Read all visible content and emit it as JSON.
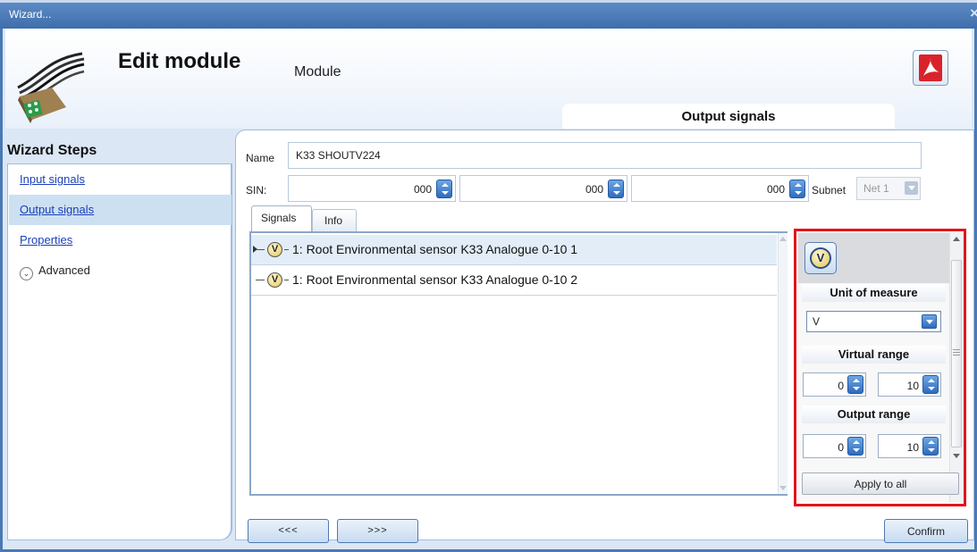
{
  "window": {
    "title": "Wizard...",
    "close": "×"
  },
  "header": {
    "title": "Edit module",
    "subtitle": "Module",
    "step_tab": "Output signals"
  },
  "sidebar": {
    "title": "Wizard Steps",
    "items": [
      {
        "label": "Input signals",
        "selected": false
      },
      {
        "label": "Output signals",
        "selected": true
      },
      {
        "label": "Properties",
        "selected": false
      }
    ],
    "advanced": {
      "label": "Advanced",
      "icon": "chevron-down-circle-icon"
    }
  },
  "form": {
    "name_label": "Name",
    "name_value": "K33 SHOUTV224",
    "sin_label": "SIN:",
    "sin_values": [
      "000",
      "000",
      "000"
    ],
    "subnet_label": "Subnet",
    "subnet_value": "Net 1"
  },
  "tabs": {
    "signals": "Signals",
    "info": "Info"
  },
  "signals": [
    {
      "text": "1: Root Environmental sensor K33 Analogue 0-10 1",
      "icon": "V",
      "selected": true
    },
    {
      "text": "1: Root Environmental sensor K33 Analogue 0-10 2",
      "icon": "V",
      "selected": false
    }
  ],
  "properties": {
    "icon": "V",
    "unit_title": "Unit of measure",
    "unit_value": "V",
    "virtual_title": "Virtual range",
    "virtual_min": "0",
    "virtual_max": "10",
    "output_title": "Output range",
    "output_min": "0",
    "output_max": "10",
    "apply_label": "Apply to all",
    "highlight_color": "#e3141c"
  },
  "nav": {
    "prev": "<<<",
    "next": ">>>",
    "confirm": "Confirm"
  }
}
